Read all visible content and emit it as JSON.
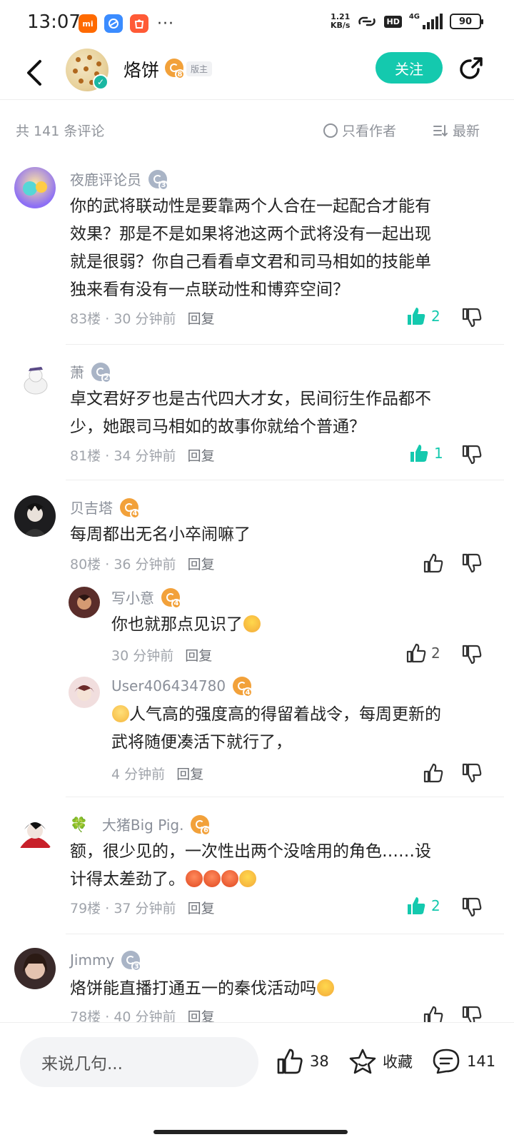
{
  "status_bar": {
    "time": "13:07",
    "apps": [
      {
        "icon": "mi-app-icon",
        "label": "mi",
        "color": "#ff6a00"
      },
      {
        "icon": "browser-app-icon",
        "label": "",
        "color": "#3b8cff"
      },
      {
        "icon": "store-app-icon",
        "label": "",
        "color": "#ff5a36"
      }
    ],
    "more": "···",
    "net_speed_value": "1.21",
    "net_speed_unit": "KB/s",
    "hd": "HD",
    "network": "4G",
    "battery": "90"
  },
  "header": {
    "name": "烙饼",
    "level": "8",
    "role": "版主",
    "follow_label": "关注"
  },
  "filter": {
    "count_label": "共 141 条评论",
    "author_only": "只看作者",
    "sort_label": "最新"
  },
  "comments": [
    {
      "user": "夜鹿评论员",
      "level": "3",
      "badge": "blue",
      "lines": [
        "你的武将联动性是要靠两个人合在一起配合才能有",
        "效果？那是不是如果将池这两个武将没有一起出现",
        "就是很弱？你自己看看卓文君和司马相如的技能单",
        "独来看有没有一点联动性和博弈空间？"
      ],
      "floor": "83楼",
      "time": "30 分钟前",
      "reply": "回复",
      "likes": "2",
      "liked": true
    },
    {
      "user": "萧",
      "level": "2",
      "badge": "blue",
      "lines": [
        "卓文君好歹也是古代四大才女，民间衍生作品都不",
        "少，她跟司马相如的故事你就给个普通？"
      ],
      "floor": "81楼",
      "time": "34 分钟前",
      "reply": "回复",
      "likes": "1",
      "liked": true
    },
    {
      "user": "贝吉塔",
      "level": "4",
      "badge": "gold",
      "lines": [
        "每周都出无名小卒闹嘛了"
      ],
      "floor": "80楼",
      "time": "36 分钟前",
      "reply": "回复",
      "likes": "",
      "liked": false,
      "replies": [
        {
          "user": "写小意",
          "level": "4",
          "badge": "gold",
          "lines": [
            "你也就那点见识了"
          ],
          "time": "30 分钟前",
          "reply": "回复",
          "likes": "2"
        },
        {
          "user": "User406434780",
          "level": "4",
          "badge": "gold",
          "lines": [
            "人气高的强度高的得留着战令，每周更新的",
            "武将随便凑活下就行了，"
          ],
          "time": "4 分钟前",
          "reply": "回复",
          "likes": ""
        }
      ]
    },
    {
      "user": "大猪Big Pig.",
      "level": "6",
      "badge": "gold",
      "lines": [
        "额，很少见的，一次性出两个没啥用的角色……设",
        "计得太差劲了。"
      ],
      "floor": "79楼",
      "time": "37 分钟前",
      "reply": "回复",
      "likes": "2",
      "liked": true
    },
    {
      "user": "Jimmy",
      "level": "3",
      "badge": "blue",
      "lines": [
        "烙饼能直播打通五一的秦伐活动吗"
      ],
      "floor": "78楼",
      "time": "40 分钟前",
      "reply": "回复",
      "likes": "",
      "liked": false
    }
  ],
  "bottom_bar": {
    "input_placeholder": "来说几句...",
    "likes": "38",
    "favorite_label": "收藏",
    "comments": "141"
  },
  "colors": {
    "accent": "#14c9ae",
    "gold_badge": "#f2a13a",
    "blue_badge": "#a9b4c6",
    "meta_text": "#a0a4ab"
  }
}
